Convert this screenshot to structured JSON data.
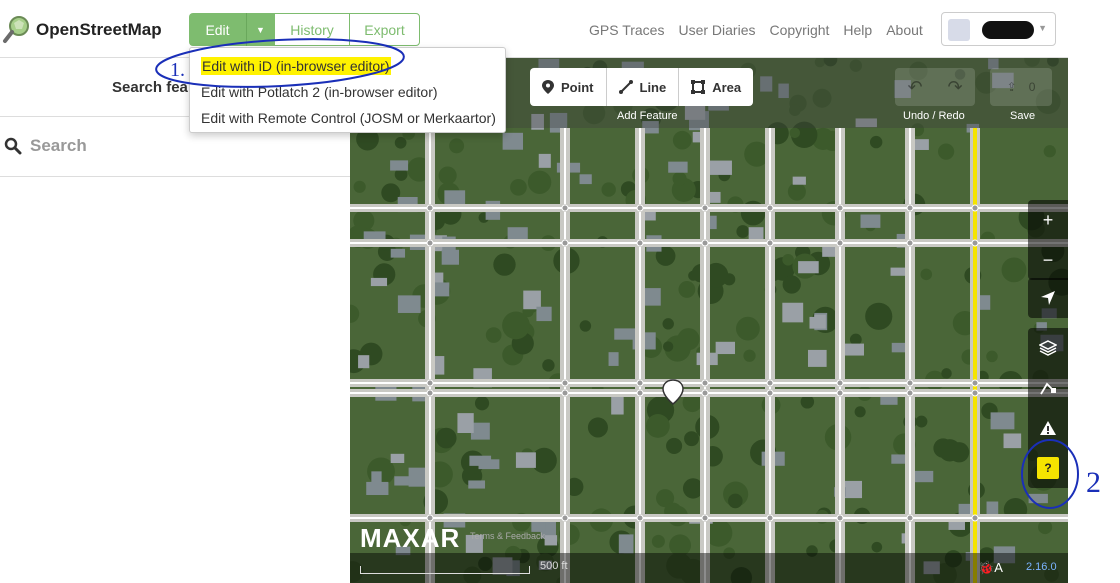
{
  "app": {
    "brand": "OpenStreetMap"
  },
  "header": {
    "edit_label": "Edit",
    "history_label": "History",
    "export_label": "Export",
    "nav": [
      "GPS Traces",
      "User Diaries",
      "Copyright",
      "Help",
      "About"
    ]
  },
  "edit_dropdown": {
    "items": [
      "Edit with iD (in-browser editor)",
      "Edit with Potlatch 2 (in-browser editor)",
      "Edit with Remote Control (JOSM or Merkaartor)"
    ],
    "highlight_color": "#fff200"
  },
  "sidebar": {
    "heading": "Search fea",
    "search_placeholder": "Search"
  },
  "toolbar": {
    "point_label": "Point",
    "line_label": "Line",
    "area_label": "Area",
    "add_feature_label": "Add Feature",
    "undo_redo_label": "Undo / Redo",
    "save_label": "Save",
    "save_count": "0"
  },
  "map_controls": {
    "zoom_in": "+",
    "zoom_out": "−",
    "help_icon": "?"
  },
  "footer": {
    "imagery_brand": "MAXAR",
    "terms": "Terms & Feedback",
    "scale": "500 ft",
    "version": "2.16.0"
  },
  "annotations": {
    "note_1": "1.",
    "note_2": "2",
    "ink_color": "#1a2fb8"
  },
  "colors": {
    "accent": "#7ebc6f",
    "road_highlight": "#f5e400"
  }
}
